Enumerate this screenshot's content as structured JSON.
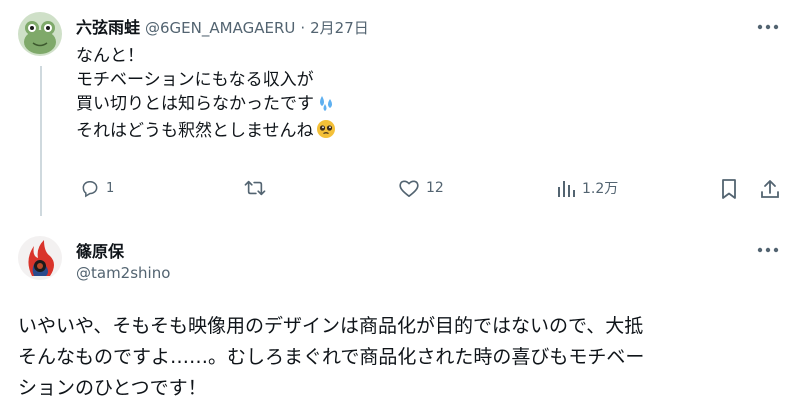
{
  "tweet": {
    "author_name": "六弦雨蛙",
    "handle": "@6GEN_AMAGAERU",
    "separator": "·",
    "date": "2月27日",
    "lines": [
      "なんと！",
      "モチベーションにもなる収入が",
      "買い切りとは知らなかったです",
      "それはどうも釈然としませんね"
    ],
    "emojis": [
      "sweat-droplets-emoji",
      "pleading-face-emoji"
    ],
    "actions": {
      "reply_count": "1",
      "retweet_count": "",
      "like_count": "12",
      "views_count": "1.2万"
    },
    "icons": [
      "more-icon",
      "reply-icon",
      "retweet-icon",
      "like-icon",
      "views-icon",
      "bookmark-icon",
      "share-icon"
    ]
  },
  "reply": {
    "author_name": "篠原保",
    "handle": "@tam2shino",
    "lines": [
      "いやいや、そもそも映像用のデザインは商品化が目的ではないので、大抵",
      "そんなものですよ……。むしろまぐれで商品化された時の喜びもモチベー",
      "ションのひとつです！"
    ]
  },
  "colors": {
    "text": "#0f1419",
    "secondary": "#536471",
    "divider": "#cfd9de",
    "emoji_drop": "#5fb0f0",
    "emoji_face": "#f4c038"
  }
}
